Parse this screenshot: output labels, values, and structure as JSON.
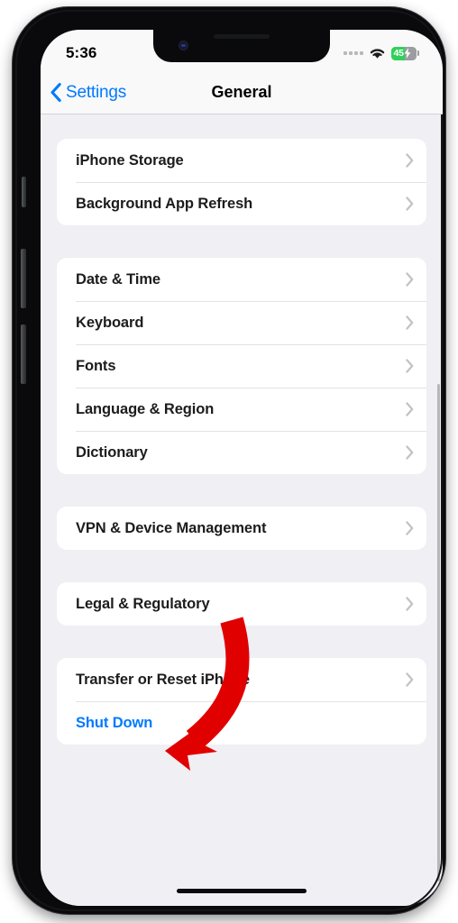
{
  "status_bar": {
    "time": "5:36",
    "signal_icon": "cellular-dots-icon",
    "wifi_icon": "wifi-icon",
    "battery_level": "45",
    "battery_charging_icon": "lightning-bolt-icon",
    "battery_color": "#30d158"
  },
  "nav": {
    "back_label": "Settings",
    "back_icon": "chevron-left-icon",
    "title": "General"
  },
  "theme": {
    "accent": "#007aff",
    "background": "#efeff4",
    "card": "#ffffff",
    "annotation": "#e00000"
  },
  "groups": [
    {
      "rows": [
        {
          "label": "iPhone Storage",
          "accessory": "chevron-right-icon",
          "style": "normal"
        },
        {
          "label": "Background App Refresh",
          "accessory": "chevron-right-icon",
          "style": "normal"
        }
      ]
    },
    {
      "rows": [
        {
          "label": "Date & Time",
          "accessory": "chevron-right-icon",
          "style": "normal"
        },
        {
          "label": "Keyboard",
          "accessory": "chevron-right-icon",
          "style": "normal"
        },
        {
          "label": "Fonts",
          "accessory": "chevron-right-icon",
          "style": "normal"
        },
        {
          "label": "Language & Region",
          "accessory": "chevron-right-icon",
          "style": "normal"
        },
        {
          "label": "Dictionary",
          "accessory": "chevron-right-icon",
          "style": "normal"
        }
      ]
    },
    {
      "rows": [
        {
          "label": "VPN & Device Management",
          "accessory": "chevron-right-icon",
          "style": "normal"
        }
      ]
    },
    {
      "rows": [
        {
          "label": "Legal & Regulatory",
          "accessory": "chevron-right-icon",
          "style": "normal"
        }
      ]
    },
    {
      "rows": [
        {
          "label": "Transfer or Reset iPhone",
          "accessory": "chevron-right-icon",
          "style": "normal"
        },
        {
          "label": "Shut Down",
          "accessory": "none",
          "style": "link"
        }
      ]
    }
  ],
  "annotation": {
    "type": "curved-arrow",
    "color": "#e00000",
    "points_to": "Shut Down"
  },
  "hardware": {
    "mute_switch": "mute-switch",
    "volume_up": "volume-up-button",
    "volume_down": "volume-down-button",
    "power": "power-button",
    "home_indicator": "home-indicator"
  }
}
